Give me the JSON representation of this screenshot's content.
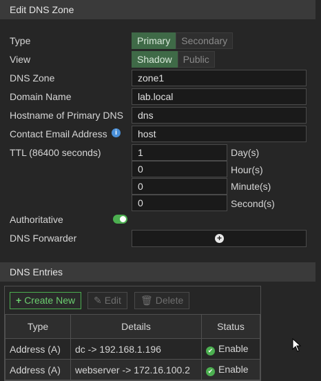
{
  "header": {
    "title": "Edit DNS Zone"
  },
  "form": {
    "type_label": "Type",
    "type_options": [
      "Primary",
      "Secondary"
    ],
    "view_label": "View",
    "view_options": [
      "Shadow",
      "Public"
    ],
    "zone_label": "DNS Zone",
    "zone_value": "zone1",
    "domain_label": "Domain Name",
    "domain_value": "lab.local",
    "hostname_label": "Hostname of Primary DNS",
    "hostname_value": "dns",
    "email_label": "Contact Email Address",
    "email_value": "host",
    "ttl_label": "TTL (86400 seconds)",
    "ttl": [
      {
        "value": "1",
        "unit": "Day(s)"
      },
      {
        "value": "0",
        "unit": "Hour(s)"
      },
      {
        "value": "0",
        "unit": "Minute(s)"
      },
      {
        "value": "0",
        "unit": "Second(s)"
      }
    ],
    "authoritative_label": "Authoritative",
    "forwarder_label": "DNS Forwarder"
  },
  "entries": {
    "title": "DNS Entries",
    "create_label": "Create New",
    "edit_label": "Edit",
    "delete_label": "Delete",
    "columns": [
      "Type",
      "Details",
      "Status"
    ],
    "rows": [
      {
        "type": "Address (A)",
        "details": "dc -> 192.168.1.196",
        "status": "Enable"
      },
      {
        "type": "Address (A)",
        "details": "webserver -> 172.16.100.2",
        "status": "Enable"
      }
    ]
  },
  "colors": {
    "accent_green": "#4caf50",
    "selected_segment": "#3f6a47",
    "info_blue": "#4a90d9"
  }
}
